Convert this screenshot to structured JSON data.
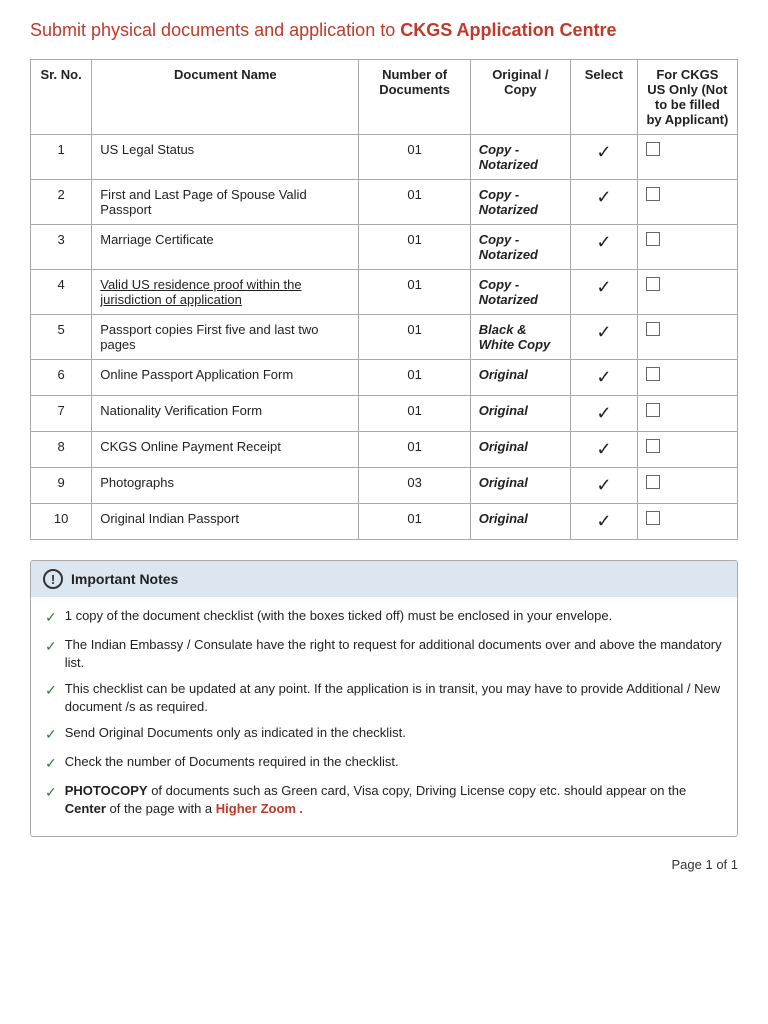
{
  "title": {
    "prefix": "Submit physical documents and application to ",
    "bold": "CKGS Application Centre"
  },
  "table": {
    "headers": {
      "srno": "Sr. No.",
      "docname": "Document Name",
      "numdocs": "Number of Documents",
      "origcopy": "Original / Copy",
      "select": "Select",
      "forckgs": "For CKGS US Only (Not to be filled by Applicant)"
    },
    "rows": [
      {
        "id": 1,
        "srno": "1",
        "docname": "US Legal Status",
        "numdocs": "01",
        "origcopy": "Copy - Notarized",
        "select": "✓",
        "underline": false
      },
      {
        "id": 2,
        "srno": "2",
        "docname": "First and Last Page of Spouse Valid Passport",
        "numdocs": "01",
        "origcopy": "Copy - Notarized",
        "select": "✓",
        "underline": false
      },
      {
        "id": 3,
        "srno": "3",
        "docname": "Marriage Certificate",
        "numdocs": "01",
        "origcopy": "Copy - Notarized",
        "select": "✓",
        "underline": false
      },
      {
        "id": 4,
        "srno": "4",
        "docname": "Valid US residence proof within the jurisdiction of application",
        "numdocs": "01",
        "origcopy": "Copy - Notarized",
        "select": "✓",
        "underline": true
      },
      {
        "id": 5,
        "srno": "5",
        "docname": "Passport copies First five and last two pages",
        "numdocs": "01",
        "origcopy": "Black & White Copy",
        "select": "✓",
        "underline": false
      },
      {
        "id": 6,
        "srno": "6",
        "docname": "Online Passport Application Form",
        "numdocs": "01",
        "origcopy": "Original",
        "select": "✓",
        "underline": false
      },
      {
        "id": 7,
        "srno": "7",
        "docname": "Nationality Verification Form",
        "numdocs": "01",
        "origcopy": "Original",
        "select": "✓",
        "underline": false
      },
      {
        "id": 8,
        "srno": "8",
        "docname": "CKGS Online Payment Receipt",
        "numdocs": "01",
        "origcopy": "Original",
        "select": "✓",
        "underline": false
      },
      {
        "id": 9,
        "srno": "9",
        "docname": "Photographs",
        "numdocs": "03",
        "origcopy": "Original",
        "select": "✓",
        "underline": false
      },
      {
        "id": 10,
        "srno": "10",
        "docname": "Original Indian Passport",
        "numdocs": "01",
        "origcopy": "Original",
        "select": "✓",
        "underline": false
      }
    ]
  },
  "notes": {
    "header": "Important Notes",
    "items": [
      "1 copy of the document checklist (with the boxes ticked off) must be enclosed in your envelope.",
      "The Indian Embassy / Consulate have the right to request for additional documents over and above the mandatory list.",
      "This checklist can be updated at any point. If the application is in transit, you may have to provide Additional / New document /s as required.",
      "Send Original Documents only as indicated in the checklist.",
      "Check the number of Documents required in the checklist.",
      "PHOTOCOPY_of documents such as Green card, Visa copy, Driving License copy etc. should appear on the Center_of the page with a _Higher Zoom ."
    ]
  },
  "footer": {
    "page_info": "Page 1 of 1"
  }
}
